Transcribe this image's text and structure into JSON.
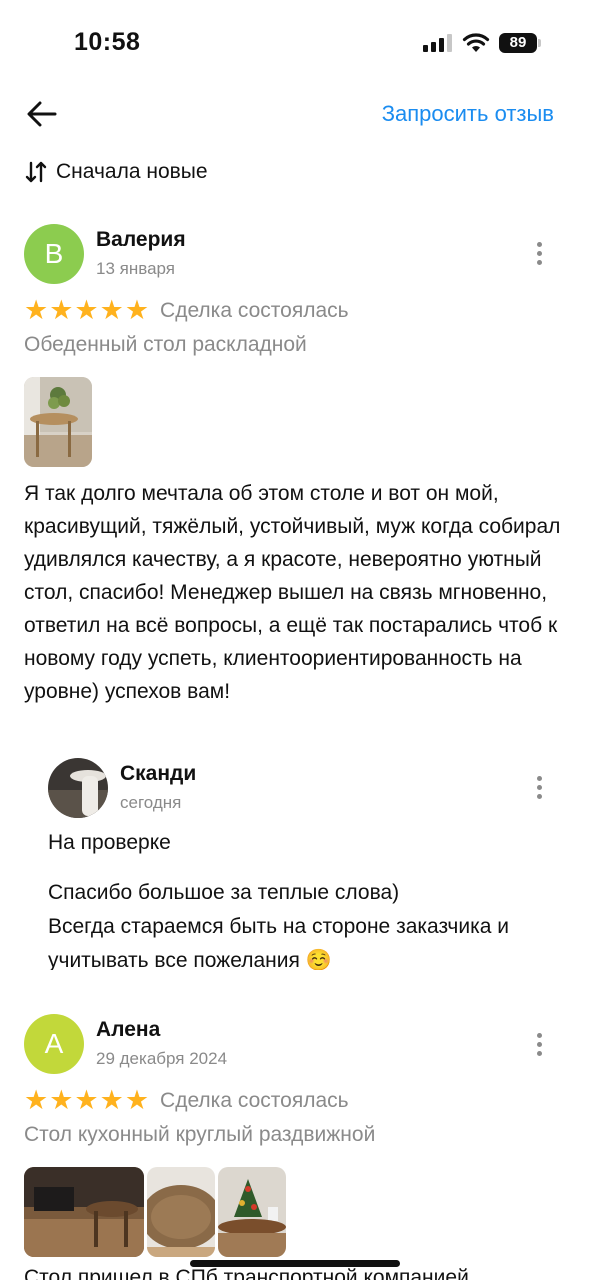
{
  "status_bar": {
    "time": "10:58",
    "battery": "89"
  },
  "header": {
    "back_icon": "arrow-left-icon",
    "request_review": "Запросить отзыв"
  },
  "sort": {
    "icon": "sort-arrows-icon",
    "label": "Сначала новые"
  },
  "reviews": [
    {
      "avatar_letter": "В",
      "avatar_color": "#8ccc4f",
      "author": "Валерия",
      "date": "13 января",
      "stars": "★★★★★",
      "deal_status": "Сделка состоялась",
      "item": "Обеденный стол раскладной",
      "text": "Я так долго мечтала об этом столе и вот он мой, красивущий, тяжёлый, устойчивый, муж когда собирал удивлялся качеству, а я красоте, невероятно уютный стол, спасибо! Менеджер вышел на связь мгновенно, ответил на всё вопросы, а ещё так постарались чтоб к новому году успеть, клиентоориентированность на уровне) успехов вам!",
      "reply": {
        "author": "Сканди",
        "date": "сегодня",
        "status": "На проверке",
        "text": "Спасибо большое за теплые слова)\nВсегда стараемся быть на стороне заказчика и учитывать все пожелания ☺️"
      }
    },
    {
      "avatar_letter": "А",
      "avatar_color": "#c2d83a",
      "author": "Алена",
      "date": "29 декабря 2024",
      "stars": "★★★★★",
      "deal_status": "Сделка состоялась",
      "item": "Стол кухонный круглый раздвижной",
      "text_partial": "Стол пришел в СПб транспортной компанией"
    }
  ],
  "colors": {
    "accent": "#1a8cf0",
    "star": "#ffb21e",
    "muted": "#8a8a8a"
  }
}
